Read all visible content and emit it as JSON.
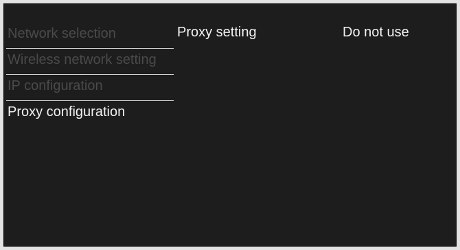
{
  "menu": {
    "items": [
      {
        "label": "Network selection"
      },
      {
        "label": "Wireless network setting"
      },
      {
        "label": "IP configuration"
      },
      {
        "label": "Proxy configuration"
      }
    ]
  },
  "setting": {
    "label": "Proxy setting",
    "value": "Do not use"
  },
  "colors": {
    "background": "#1d1d1d",
    "inactive_text": "#4a4a4a",
    "active_text": "#f2f2f2"
  }
}
